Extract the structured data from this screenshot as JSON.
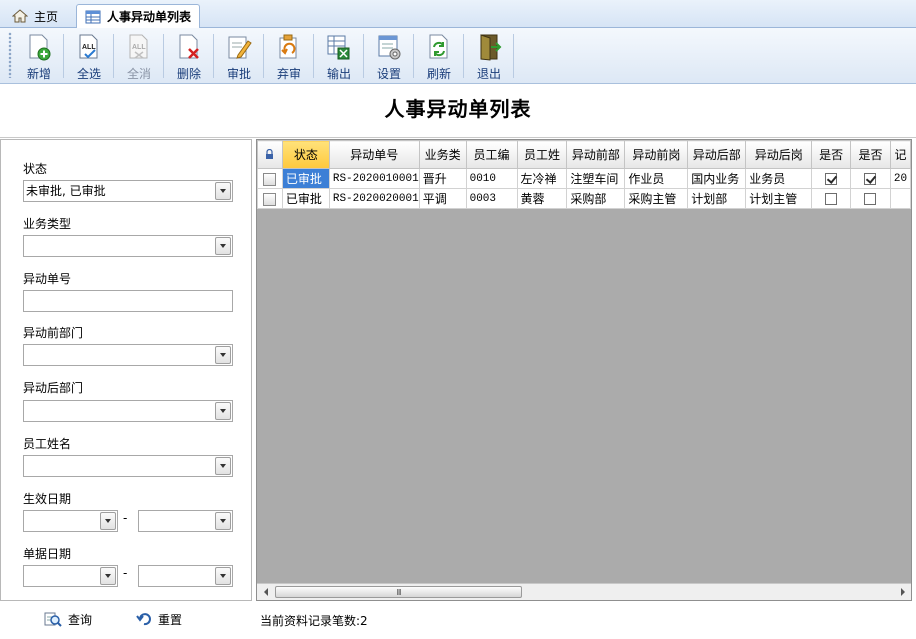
{
  "tabs": [
    {
      "label": "主页",
      "icon": "home-icon"
    },
    {
      "label": "人事异动单列表",
      "icon": "table-icon"
    }
  ],
  "toolbar": {
    "buttons": [
      {
        "label": "新增",
        "icon": "add-document-icon",
        "enabled": true
      },
      {
        "label": "全选",
        "icon": "select-all-icon",
        "enabled": true
      },
      {
        "label": "全消",
        "icon": "deselect-all-icon",
        "enabled": false
      },
      {
        "label": "删除",
        "icon": "delete-document-icon",
        "enabled": true
      },
      {
        "label": "审批",
        "icon": "approve-edit-icon",
        "enabled": true
      },
      {
        "label": "弃审",
        "icon": "unapprove-icon",
        "enabled": true
      },
      {
        "label": "输出",
        "icon": "export-excel-icon",
        "enabled": true
      },
      {
        "label": "设置",
        "icon": "settings-icon",
        "enabled": true
      },
      {
        "label": "刷新",
        "icon": "refresh-icon",
        "enabled": true
      },
      {
        "label": "退出",
        "icon": "exit-door-icon",
        "enabled": true
      }
    ]
  },
  "page_title": "人事异动单列表",
  "filter": {
    "status_label": "状态",
    "status_value": "未审批, 已审批",
    "biz_type_label": "业务类型",
    "biz_type_value": "",
    "doc_no_label": "异动单号",
    "doc_no_value": "",
    "dept_before_label": "异动前部门",
    "dept_before_value": "",
    "dept_after_label": "异动后部门",
    "dept_after_value": "",
    "emp_name_label": "员工姓名",
    "emp_name_value": "",
    "effective_date_label": "生效日期",
    "doc_date_label": "单据日期",
    "range_separator": "-"
  },
  "actions": {
    "query_label": "查询",
    "reset_label": "重置"
  },
  "grid": {
    "columns": [
      "状态",
      "异动单号",
      "业务类",
      "员工编",
      "员工姓",
      "异动前部",
      "异动前岗",
      "异动后部",
      "异动后岗",
      "是否",
      "是否",
      "记"
    ],
    "rows": [
      {
        "status": "已审批",
        "doc_no": "RS-2020010001",
        "biz_type": "晋升",
        "emp_no": "0010",
        "emp_name": "左冷禅",
        "dept_before": "注塑车间",
        "post_before": "作业员",
        "dept_after": "国内业务",
        "post_after": "业务员",
        "flag1": true,
        "flag2": true,
        "more": "20"
      },
      {
        "status": "已审批",
        "doc_no": "RS-2020020001",
        "biz_type": "平调",
        "emp_no": "0003",
        "emp_name": "黄蓉",
        "dept_before": "采购部",
        "post_before": "采购主管",
        "dept_after": "计划部",
        "post_after": "计划主管",
        "flag1": false,
        "flag2": false,
        "more": ""
      }
    ],
    "scroll_thumb_glyph": "III"
  },
  "status_bar": "当前资料记录笔数:2",
  "colors": {
    "accent": "#3c7fd6",
    "sorted_header": "#ffc83d",
    "grid_bg": "#ababab"
  }
}
